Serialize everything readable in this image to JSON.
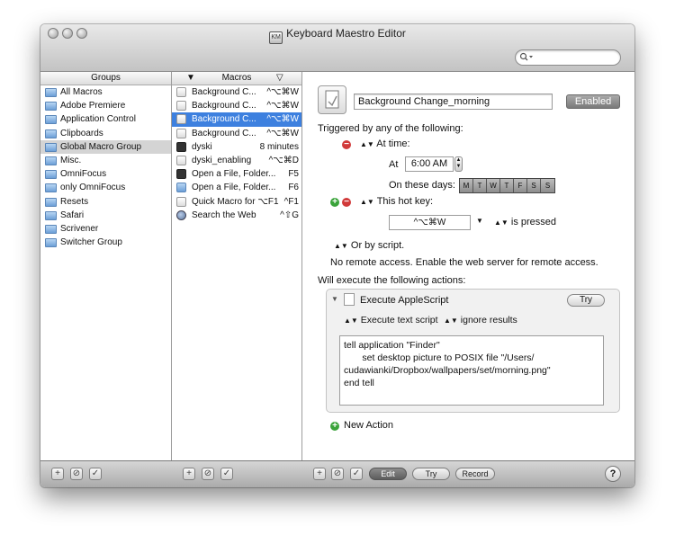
{
  "window": {
    "title": "Keyboard Maestro Editor",
    "search_placeholder": ""
  },
  "groups": {
    "header": "Groups",
    "items": [
      {
        "label": "All Macros",
        "selected": false
      },
      {
        "label": "Adobe Premiere",
        "selected": false
      },
      {
        "label": "Application Control",
        "selected": false
      },
      {
        "label": "Clipboards",
        "selected": false
      },
      {
        "label": "Global Macro Group",
        "selected": true
      },
      {
        "label": "Misc.",
        "selected": false
      },
      {
        "label": "OmniFocus",
        "selected": false
      },
      {
        "label": "only OmniFocus",
        "selected": false
      },
      {
        "label": "Resets",
        "selected": false
      },
      {
        "label": "Safari",
        "selected": false
      },
      {
        "label": "Scrivener",
        "selected": false
      },
      {
        "label": "Switcher Group",
        "selected": false
      }
    ]
  },
  "macros": {
    "header": "Macros",
    "sort_arrow": "▼",
    "filter_icon": "▽",
    "items": [
      {
        "name": "Background C...",
        "key": "^⌥⌘W",
        "icon": "script-icon",
        "selected": false
      },
      {
        "name": "Background C...",
        "key": "^⌥⌘W",
        "icon": "script-icon",
        "selected": false
      },
      {
        "name": "Background C...",
        "key": "^⌥⌘W",
        "icon": "script-icon",
        "selected": true
      },
      {
        "name": "Background C...",
        "key": "^⌥⌘W",
        "icon": "script-icon",
        "selected": false
      },
      {
        "name": "dyski",
        "key": "8 minutes",
        "icon": "terminal-icon",
        "selected": false
      },
      {
        "name": "dyski_enabling",
        "key": "^⌥⌘D",
        "icon": "script-icon",
        "selected": false
      },
      {
        "name": "Open a File, Folder...",
        "key": "F5",
        "icon": "terminal-icon",
        "selected": false
      },
      {
        "name": "Open a File, Folder...",
        "key": "F6",
        "icon": "folder-icon",
        "selected": false
      },
      {
        "name": "Quick Macro for ⌥F1",
        "key": "^F1",
        "icon": "script-icon",
        "selected": false
      },
      {
        "name": "Search the Web",
        "key": "^⇧G",
        "icon": "globe-icon",
        "selected": false
      }
    ]
  },
  "editor": {
    "macro_name": "Background Change_morning",
    "enabled_label": "Enabled",
    "trigger_heading": "Triggered by any of the following:",
    "at_time": {
      "label": "At time:",
      "at_label": "At",
      "time_value": "6:00 AM",
      "days_label": "On these days:",
      "days": [
        "M",
        "T",
        "W",
        "T",
        "F",
        "S",
        "S"
      ]
    },
    "hotkey": {
      "label": "This hot key:",
      "value": "^⌥⌘W",
      "state": "is pressed"
    },
    "or_by_script": "Or by script.",
    "remote_note": "No remote access.  Enable the web server for remote access.",
    "actions_heading": "Will execute the following actions:",
    "action": {
      "title": "Execute AppleScript",
      "try_label": "Try",
      "mode": "Execute text script",
      "results": "ignore results",
      "script": "tell application \"Finder\"\n       set desktop picture to POSIX file \"/Users/\ncudawianki/Dropbox/wallpapers/set/morning.png\"\nend tell"
    },
    "new_action": "New Action"
  },
  "bottom": {
    "edit_label": "Edit",
    "try_label": "Try",
    "record_label": "Record",
    "help_label": "?"
  }
}
